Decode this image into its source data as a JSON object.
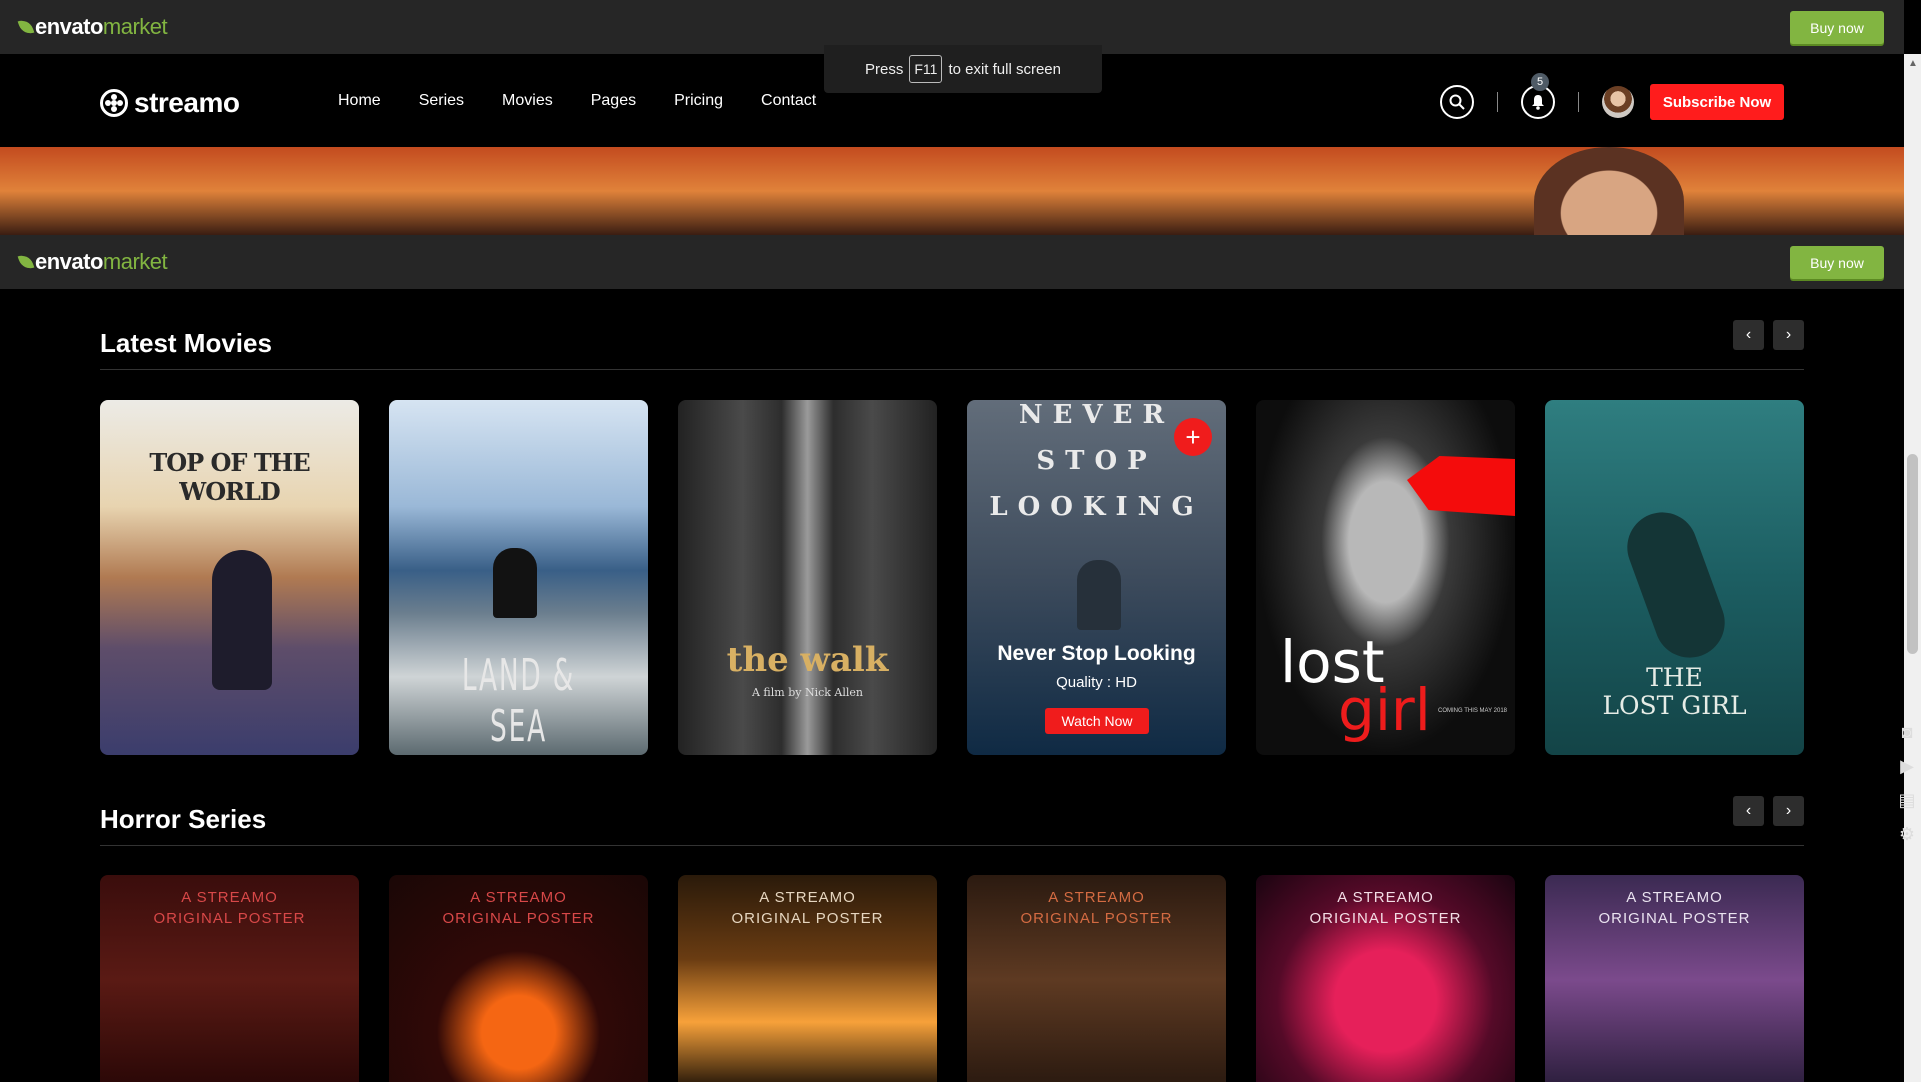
{
  "envato": {
    "brand_a": "envato",
    "brand_b": "market",
    "buy_label": "Buy now"
  },
  "fullscreen_toast": {
    "before": "Press",
    "key": "F11",
    "after": "to exit full screen"
  },
  "nav": {
    "brand": "streamo",
    "menu": [
      "Home",
      "Series",
      "Movies",
      "Pages",
      "Pricing",
      "Contact"
    ],
    "notification_count": "5",
    "subscribe_label": "Subscribe Now"
  },
  "latest_movies": {
    "title": "Latest Movies",
    "cards": [
      {
        "title": "TOP OF THE WORLD"
      },
      {
        "title": "LAND & SEA"
      },
      {
        "title": "the walk",
        "subtitle": "A film by Nick Allen"
      },
      {
        "poster_text": [
          "NEVER",
          "STOP",
          "LOOKING"
        ],
        "name": "Never Stop Looking",
        "quality": "Quality : HD",
        "watch_label": "Watch Now"
      },
      {
        "title_a": "lost",
        "title_b": "girl",
        "note": "COMING THIS MAY 2018"
      },
      {
        "title_line1": "THE",
        "title_line2": "LOST GIRL"
      }
    ]
  },
  "horror_series": {
    "title": "Horror Series",
    "tag_line1": "A STREAMO",
    "tag_line2": "ORIGINAL POSTER"
  },
  "colors": {
    "envato_green": "#82b541",
    "accent_red": "#ff1c1c"
  }
}
